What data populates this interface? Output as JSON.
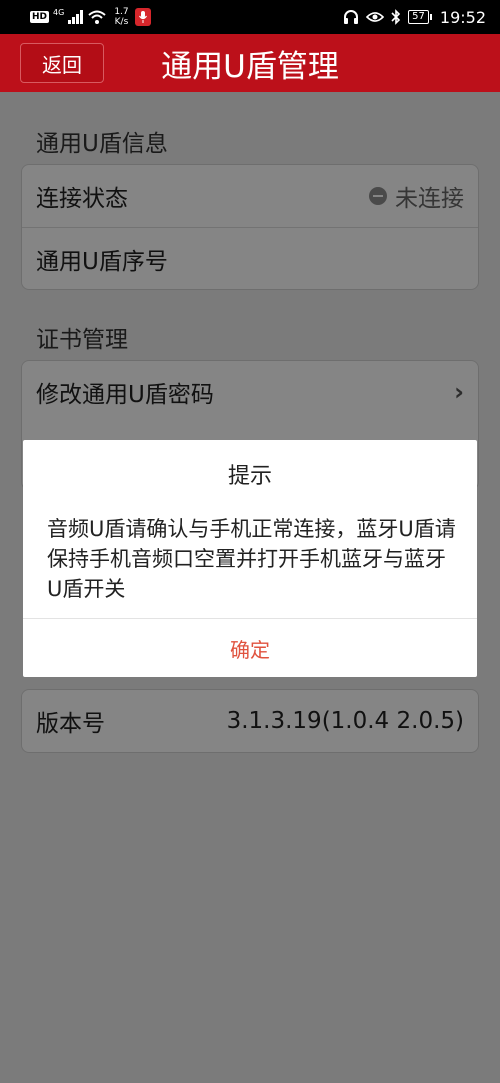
{
  "status_bar": {
    "hd": "HD",
    "network": "4G",
    "speed_value": "1.7",
    "speed_unit": "K/s",
    "battery": "57",
    "time": "19:52"
  },
  "header": {
    "back_label": "返回",
    "title": "通用U盾管理"
  },
  "sections": {
    "info_title": "通用U盾信息",
    "connection_label": "连接状态",
    "connection_value": "未连接",
    "serial_label": "通用U盾序号",
    "cert_title": "证书管理",
    "change_password_label": "修改通用U盾密码",
    "version_label": "版本号",
    "version_value": "3.1.3.19(1.0.4 2.0.5)"
  },
  "dialog": {
    "title": "提示",
    "message": "音频U盾请确认与手机正常连接，蓝牙U盾请保持手机音频口空置并打开手机蓝牙与蓝牙U盾开关",
    "ok_label": "确定"
  },
  "colors": {
    "title_bar": "#bc101a",
    "dialog_button": "#e0533f"
  }
}
